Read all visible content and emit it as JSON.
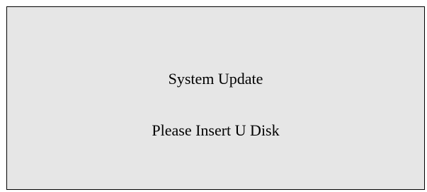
{
  "screen": {
    "title": "System Update",
    "message": "Please Insert U Disk"
  },
  "colors": {
    "panel_background": "#e6e6e6",
    "panel_border": "#000000",
    "text": "#000000"
  }
}
